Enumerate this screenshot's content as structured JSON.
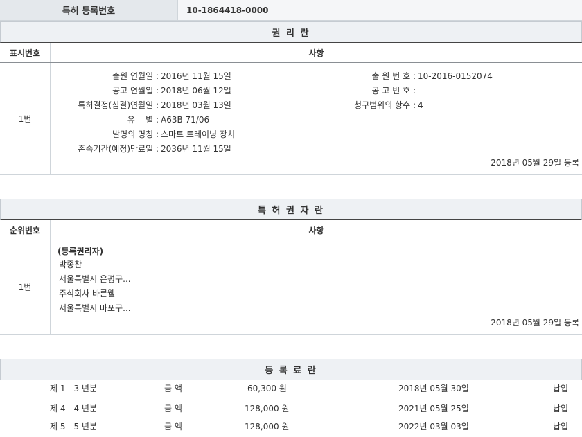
{
  "patent": {
    "label": "특허 등록번호",
    "value": "10-1864418-0000"
  },
  "rights_section": {
    "title": "권 리 란",
    "col_no": "표시번호",
    "col_content": "사항",
    "row_no": "1번",
    "left": [
      {
        "k": "출원 연월일 :",
        "v": "2016년 11월 15일"
      },
      {
        "k": "공고 연월일 :",
        "v": "2018년 06월 12일"
      },
      {
        "k": "특허결정(심결)연월일 :",
        "v": "2018년 03월 13일"
      },
      {
        "k": "유    별 :",
        "v": "A63B 71/06"
      },
      {
        "k": "발명의 명칭 :",
        "v": "스마트 트레이닝 장치"
      },
      {
        "k": "존속기간(예정)만료일 :",
        "v": "2036년 11월 15일"
      }
    ],
    "right": [
      {
        "k": "출 원 번 호 :",
        "v": "10-2016-0152074"
      },
      {
        "k": "공 고 번 호 :",
        "v": ""
      },
      {
        "k": "청구범위의 항수 :",
        "v": "4"
      }
    ],
    "reg_date": "2018년 05월 29일 등록"
  },
  "owner_section": {
    "title": "특 허 권 자 란",
    "col_no": "순위번호",
    "col_content": "사항",
    "row_no": "1번",
    "heading": "(등록권리자)",
    "lines": [
      "박종찬",
      "서울특별시 은평구...",
      "주식회사 바른웰",
      "서울특별시 마포구..."
    ],
    "reg_date": "2018년 05월 29일 등록"
  },
  "fee_section": {
    "title": "등 록 료 란",
    "rows": [
      {
        "period": "제 1 - 3 년분",
        "label": "금 액",
        "amount": "60,300 원",
        "date": "2018년 05월 30일",
        "status": "납입"
      },
      {
        "period": "제 4 - 4 년분",
        "label": "금 액",
        "amount": "128,000 원",
        "date": "2021년 05월 25일",
        "status": "납입"
      },
      {
        "period": "제 5 - 5 년분",
        "label": "금 액",
        "amount": "128,000 원",
        "date": "2022년 03월 03일",
        "status": "납입"
      }
    ]
  }
}
